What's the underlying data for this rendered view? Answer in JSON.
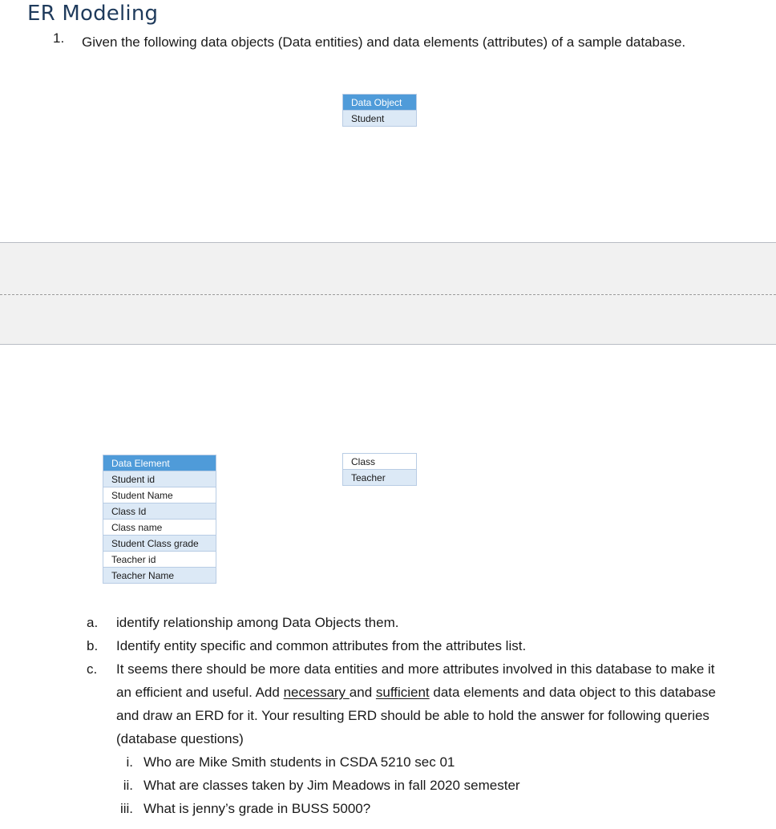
{
  "heading": "ER Modeling",
  "question": {
    "number": "1.",
    "text": "Given the following data objects (Data entities) and data elements (attributes) of a sample database."
  },
  "data_object_table": {
    "header": "Data Object",
    "rows": [
      "Student"
    ]
  },
  "data_element_table": {
    "header": "Data Element",
    "rows": [
      "Student id",
      "Student Name",
      "Class Id",
      "Class name",
      "Student Class grade",
      "Teacher id",
      "Teacher Name"
    ]
  },
  "data_object_table_2": {
    "rows": [
      "Class",
      "Teacher"
    ]
  },
  "subquestions": [
    {
      "label": "a.",
      "text": "identify relationship among Data Objects them."
    },
    {
      "label": "b.",
      "text": "Identify entity specific and common attributes from the attributes list."
    },
    {
      "label": "c.",
      "text_before": "It seems there should be more data entities  and more attributes involved in this database to make it an efficient and useful.  Add ",
      "underline_1": "necessary ",
      "text_mid": "and ",
      "underline_2": "sufficient",
      "text_after": " data elements and data object to this database and draw an ERD for it.  Your resulting ERD should be able to hold the answer for following queries (database questions)"
    }
  ],
  "queries": [
    {
      "label": "i.",
      "text": "Who are Mike Smith students in CSDA 5210 sec 01"
    },
    {
      "label": "ii.",
      "text": "What are classes taken by Jim Meadows in fall 2020 semester"
    },
    {
      "label": "iii.",
      "text": "What is jenny’s grade in BUSS 5000?"
    }
  ],
  "colors": {
    "table_header": "#4f9bd9",
    "table_band": "#dce9f6",
    "heading": "#1f3b5c"
  }
}
